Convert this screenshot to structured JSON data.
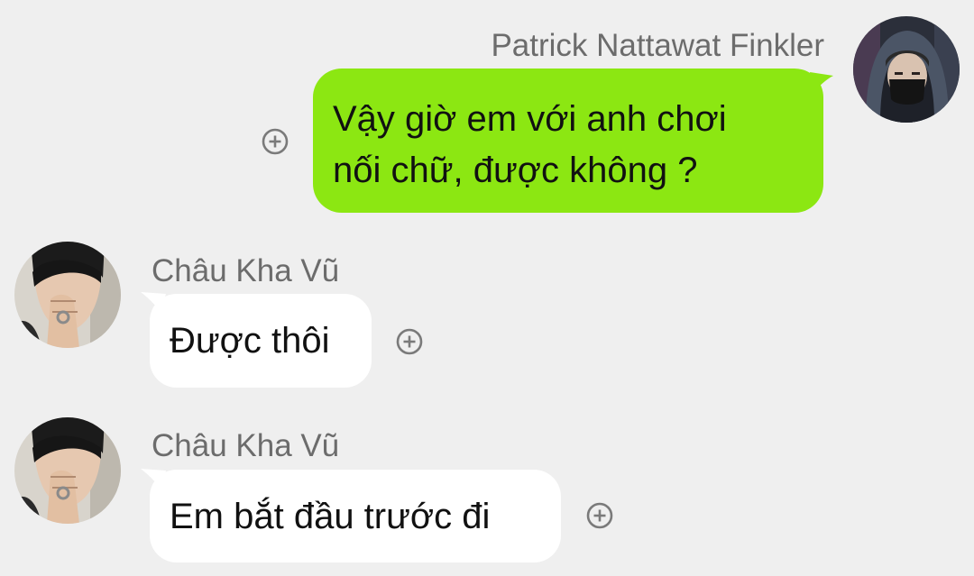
{
  "conversation": {
    "messages": [
      {
        "direction": "outgoing",
        "sender": "Patrick Nattawat Finkler",
        "lines": [
          "Vậy giờ em với anh chơi",
          "nối chữ, được không ?"
        ],
        "avatar_icon": "hooded-person-with-mask"
      },
      {
        "direction": "incoming",
        "sender": "Châu Kha Vũ",
        "text": "Được thôi",
        "avatar_icon": "person-covering-mouth"
      },
      {
        "direction": "incoming",
        "sender": "Châu Kha Vũ",
        "text": "Em bắt đầu trước đi",
        "avatar_icon": "person-covering-mouth"
      }
    ],
    "reaction_icon": "add-reaction-icon"
  },
  "colors": {
    "background": "#efefef",
    "outgoing_bubble": "#8ce712",
    "incoming_bubble": "#ffffff",
    "sender_text": "#6c6c6c",
    "message_text": "#111111",
    "reaction_icon": "#7a7a7a"
  }
}
